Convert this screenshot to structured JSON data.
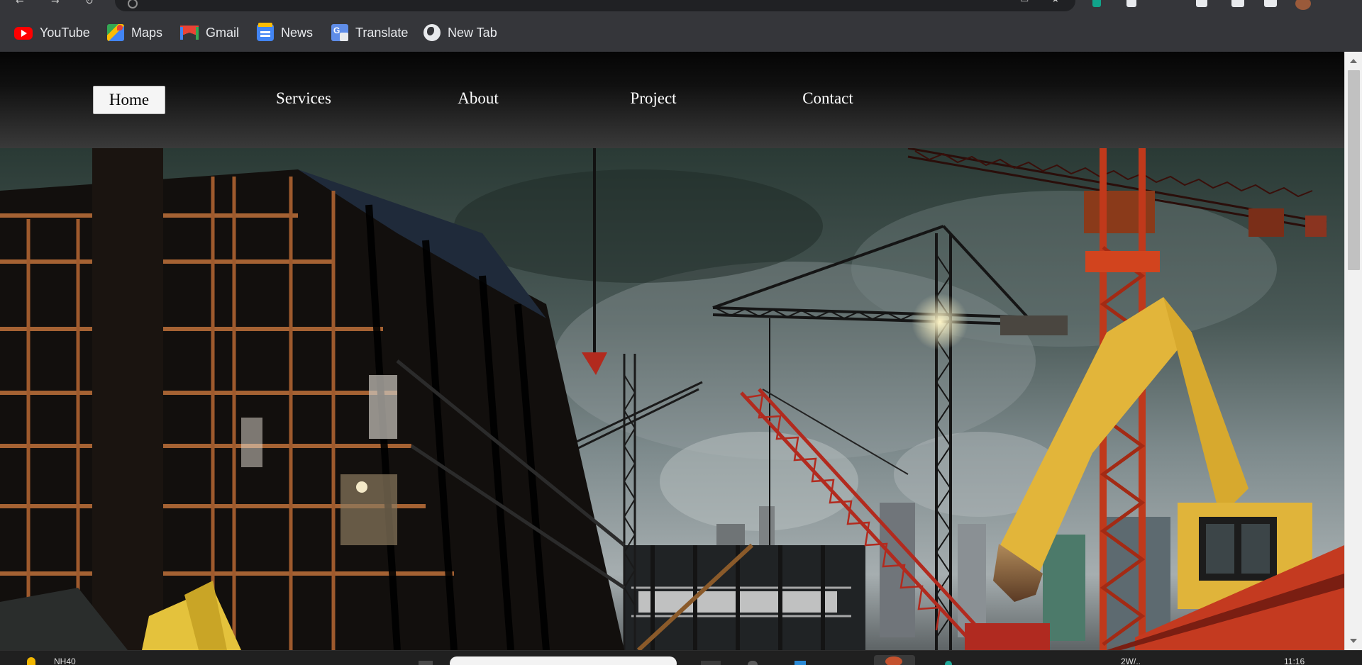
{
  "browser": {
    "bookmarks": [
      {
        "label": "YouTube",
        "icon": "youtube-icon"
      },
      {
        "label": "Maps",
        "icon": "maps-icon"
      },
      {
        "label": "Gmail",
        "icon": "gmail-icon"
      },
      {
        "label": "News",
        "icon": "news-icon"
      },
      {
        "label": "Translate",
        "icon": "translate-icon"
      },
      {
        "label": "New Tab",
        "icon": "globe-icon"
      }
    ]
  },
  "site": {
    "nav": [
      {
        "label": "Home",
        "active": true
      },
      {
        "label": "Services",
        "active": false
      },
      {
        "label": "About",
        "active": false
      },
      {
        "label": "Project",
        "active": false
      },
      {
        "label": "Contact",
        "active": false
      }
    ],
    "hero_image": "construction-site-cranes"
  },
  "taskbar": {
    "weather_text": "NH40",
    "date_partial": "2W/..",
    "time_partial": "11:16"
  },
  "colors": {
    "chrome_bg": "#35363a",
    "header_gradient_top": "#050505",
    "header_gradient_bottom": "#3a3a3a",
    "nav_active_bg": "#f5f5f5",
    "crane_red": "#b22a1e",
    "excavator_yellow": "#e2b53a"
  }
}
